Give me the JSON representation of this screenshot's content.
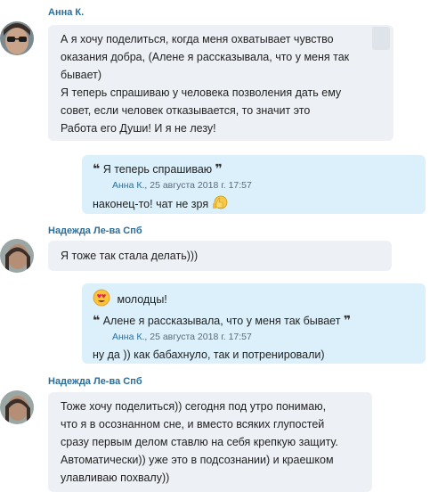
{
  "messages": [
    {
      "sender": "Анна К.",
      "lines": [
        "А я хочу поделиться, когда меня охватывает чувство",
        "оказания добра, (Алене я рассказывала, что у меня так",
        "бывает)",
        "Я теперь спрашиваю у человека позволения дать ему",
        "совет, если человек отказывается, то значит это",
        "Работа его Души! И я не лезу!"
      ]
    },
    {
      "quote": {
        "text": "Я теперь спрашиваю",
        "author": "Анна К.",
        "date": "25 августа 2018 г. 17:57"
      },
      "reply": "наконец-то! чат не зря"
    },
    {
      "sender": "Надежда Ле-ва Спб",
      "lines": [
        "Я тоже так стала делать)))"
      ]
    },
    {
      "top_text": "молодцы!",
      "quote": {
        "text": "Алене я рассказывала, что у меня так бывает",
        "author": "Анна К.",
        "date": "25 августа 2018 г. 17:57"
      },
      "reply": "ну да )) как бабахнуло, так и потренировали)"
    },
    {
      "sender": "Надежда Ле-ва Спб",
      "lines": [
        "Тоже хочу поделиться)) сегодня под утро понимаю,",
        "что я в осознанном сне, и вместо всяких глупостей",
        "сразу первым делом ставлю на себя крепкую защиту.",
        "Автоматически)) уже это в подсознании) и краешком",
        "улавливаю похвалу))"
      ]
    }
  ],
  "icons": {
    "quote_open": "❝",
    "quote_close": "❞",
    "meta_separator": ", "
  },
  "colors": {
    "incoming_bubble": "#edf1f5",
    "outgoing_bubble": "#dcf0fb",
    "sender_name": "#2a6f9b"
  }
}
